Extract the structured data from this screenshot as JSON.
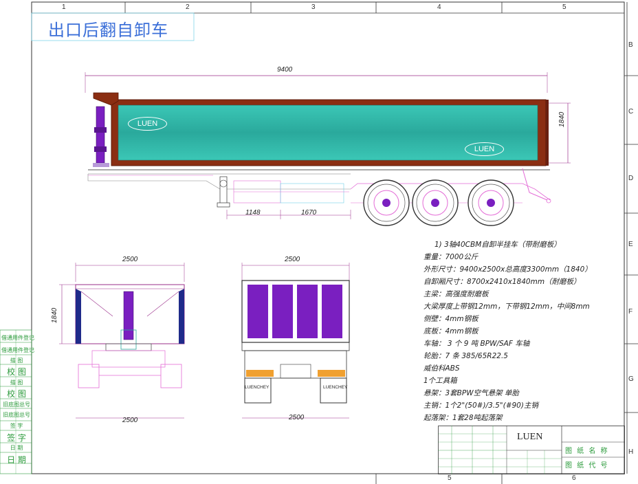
{
  "drawing_title": "出口后翻自卸车",
  "column_markers": [
    "1",
    "2",
    "3",
    "4",
    "5"
  ],
  "row_markers": [
    "B",
    "C",
    "D",
    "E",
    "F",
    "G",
    "H"
  ],
  "bottom_markers": [
    "5",
    "6"
  ],
  "brand_logo": "LUEN",
  "rear_plate_text": "LUENCHEY",
  "dimensions": {
    "overall_length": "9400",
    "body_height": "1840",
    "spacing_a": "1148",
    "spacing_b": "1670",
    "front_width": "2500",
    "front_height": "1840",
    "front_bottom_width": "2500",
    "rear_width": "2500",
    "rear_bottom_width": "2500"
  },
  "specs": [
    "1) 3轴40CBM自卸半挂车（带耐磨板）",
    "重量：7000公斤",
    "外形尺寸：9400x2500x总高度3300mm（1840）",
    "自卸厢尺寸：8700x2410x1840mm（耐磨板）",
    "主梁：高强度耐磨板",
    "大梁厚度上带钢12mm，下带钢12mm，中间8mm",
    "侧壁：4mm钢板",
    "底板：4mm钢板",
    "车轴： 3 个 9 吨 BPW/SAF 车轴",
    "轮胎：7 条 385/65R22.5",
    "威伯科ABS",
    "1个工具箱",
    "悬架：3套BPW空气悬架  单胎",
    "主销：1个2\"(50#)/3.5\"(#90)主销",
    "起落架：1套28吨起落架"
  ],
  "side_labels": [
    "借通用件登记",
    "借通用件登记",
    "描 图",
    "校 图",
    "描 图",
    "校 图",
    "旧底图总号",
    "旧底图总号",
    "签 字",
    "签 字",
    "日 期",
    "日 期"
  ],
  "title_block": {
    "logo": "LUEN",
    "right_top": "图 纸 名 称",
    "right_bottom": "图 纸 代 号"
  },
  "colors": {
    "frame": "#333333",
    "body_teal": "#2bb5a6",
    "body_brown": "#8b2e12",
    "accent_magenta": "#e36ad6",
    "purple": "#7a1fc0",
    "green": "#2a9a3a"
  }
}
